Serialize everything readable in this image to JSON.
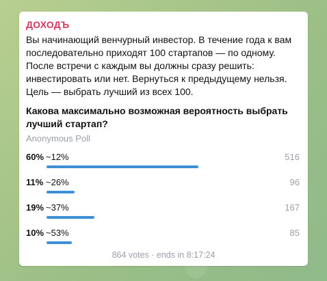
{
  "message": {
    "sender": "ДОХОДЪ",
    "text": "Вы начинающий венчурный инвестор. В течение года к вам последовательно приходят 100 стартапов — по одному. После встречи с каждым вы должны сразу решить: инвестировать или нет. Вернуться к предыдущему нельзя. Цель — выбрать лучший из всех 100.",
    "colors": {
      "sender": "#d43a5d",
      "bar": "#3f8fd6",
      "muted": "#9aa0a6"
    }
  },
  "poll": {
    "question": "Какова максимально возможная вероятность выбрать лучший стартап?",
    "type": "Anonymous Poll",
    "options": [
      {
        "percent": "60%",
        "label": "~12%",
        "votes": "516",
        "fraction": 0.6
      },
      {
        "percent": "11%",
        "label": "~26%",
        "votes": "96",
        "fraction": 0.11
      },
      {
        "percent": "19%",
        "label": "~37%",
        "votes": "167",
        "fraction": 0.19
      },
      {
        "percent": "10%",
        "label": "~53%",
        "votes": "85",
        "fraction": 0.1
      }
    ],
    "footer": "864 votes · ends in 8:17:24"
  }
}
